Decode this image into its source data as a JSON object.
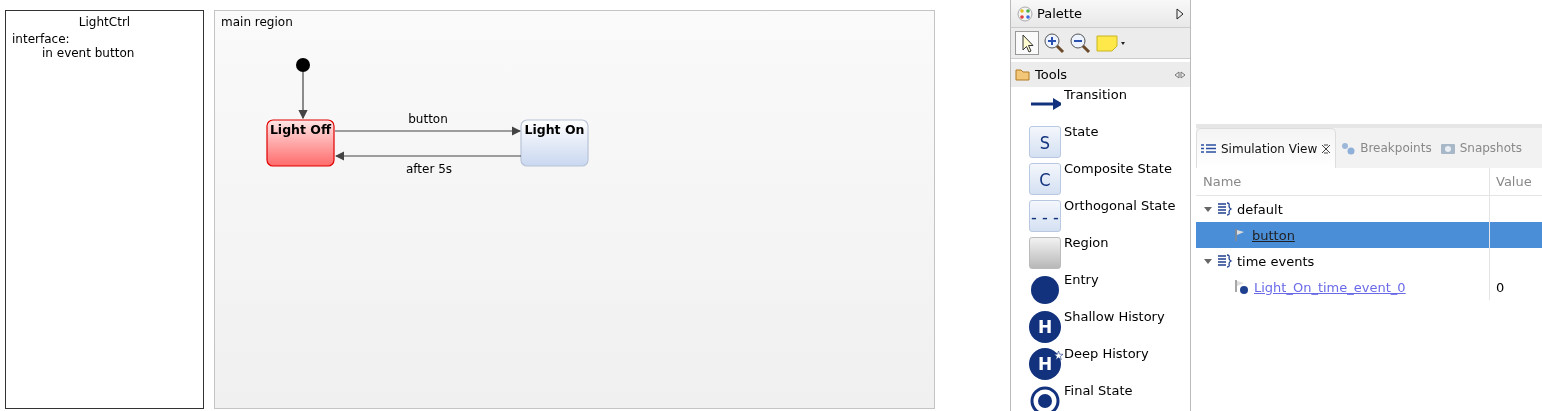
{
  "spec": {
    "title": "LightCtrl",
    "lines": [
      "interface:",
      "in event button"
    ]
  },
  "region": {
    "title": "main region",
    "states": [
      {
        "name": "Light Off",
        "active": true
      },
      {
        "name": "Light On",
        "active": false
      }
    ],
    "transitions": [
      {
        "label": "button"
      },
      {
        "label": "after 5s"
      }
    ]
  },
  "palette": {
    "title": "Palette",
    "group": "Tools",
    "tools": [
      {
        "kind": "transition",
        "label": "Transition"
      },
      {
        "kind": "letter",
        "glyph": "S",
        "label": "State"
      },
      {
        "kind": "letter",
        "glyph": "C",
        "label": "Composite State"
      },
      {
        "kind": "letter",
        "glyph": "- - -",
        "label": "Orthogonal State"
      },
      {
        "kind": "region",
        "label": "Region"
      },
      {
        "kind": "entry",
        "label": "Entry"
      },
      {
        "kind": "history",
        "glyph": "H",
        "label": "Shallow History"
      },
      {
        "kind": "deep",
        "glyph": "H",
        "label": "Deep History"
      },
      {
        "kind": "final",
        "label": "Final State"
      }
    ]
  },
  "simulation": {
    "tabs": [
      {
        "label": "Simulation View",
        "selected": true
      },
      {
        "label": "Breakpoints",
        "selected": false
      },
      {
        "label": "Snapshots",
        "selected": false
      }
    ],
    "columns": [
      "Name",
      "Value"
    ],
    "rows": [
      {
        "name": "default",
        "expanded": true,
        "selected": false,
        "children": [
          {
            "kind": "event",
            "name": "button",
            "selected": true
          }
        ]
      },
      {
        "name": "time events",
        "expanded": true,
        "selected": false,
        "children": [
          {
            "kind": "timer",
            "name": "Light_On_time_event_0",
            "value": "0",
            "selected": false
          }
        ]
      }
    ]
  }
}
